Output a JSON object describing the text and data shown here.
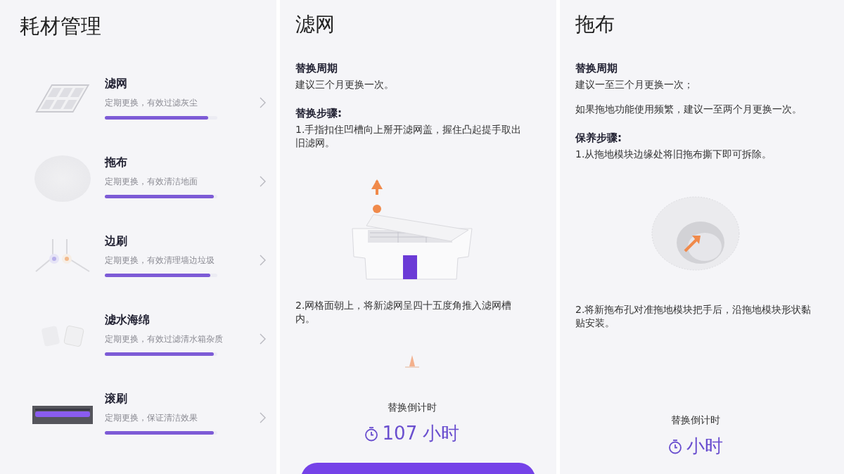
{
  "screens": [
    {
      "kind": "list",
      "title": "耗材管理",
      "items": [
        {
          "name": "滤网",
          "description": "定期更换，有效过滤灰尘",
          "level": 0.92,
          "kind": "filter"
        },
        {
          "name": "拖布",
          "description": "定期更换，有效清洁地面",
          "level": 0.97,
          "kind": "mop"
        },
        {
          "name": "边刷",
          "description": "定期更换，有效清理墙边垃圾",
          "level": 0.94,
          "kind": "side-brush"
        },
        {
          "name": "滤水海绵",
          "description": "定期更换，有效过滤清水箱杂质",
          "level": 0.97,
          "kind": "sponge"
        },
        {
          "name": "滚刷",
          "description": "定期更换，保证清洁效果",
          "level": 0.97,
          "kind": "roller-brush"
        }
      ]
    },
    {
      "kind": "detail",
      "title": "滤网",
      "blocks": [
        {
          "kind": "heading",
          "text": "替换周期"
        },
        {
          "kind": "text",
          "text": "建议三个月更换一次。"
        },
        {
          "kind": "heading",
          "text": "替换步骤:"
        },
        {
          "kind": "text",
          "text": "1.手指扣住凹槽向上掰开滤网盖，握住凸起提手取出旧滤网。"
        },
        {
          "kind": "filter-image"
        },
        {
          "kind": "text",
          "text": "2.网格面朝上，将新滤网呈四十五度角推入滤网槽内。"
        },
        {
          "kind": "arrow-image"
        }
      ],
      "countdown": {
        "label": "替换倒计时",
        "value": "107 小时"
      },
      "action_button": true
    },
    {
      "kind": "detail",
      "title": "拖布",
      "blocks": [
        {
          "kind": "heading",
          "text": "替换周期"
        },
        {
          "kind": "text",
          "text": "建议一至三个月更换一次；"
        },
        {
          "kind": "text",
          "text": "如果拖地功能使用频繁，建议一至两个月更换一次。"
        },
        {
          "kind": "heading",
          "text": "保养步骤:"
        },
        {
          "kind": "text",
          "text": "1.从拖地模块边缘处将旧拖布撕下即可拆除。"
        },
        {
          "kind": "mop-image"
        },
        {
          "kind": "text",
          "text": "2.将新拖布孔对准拖地模块把手后，沿拖地模块形状黏贴安装。"
        }
      ],
      "countdown": {
        "label": "替换倒计时",
        "value": "小时"
      },
      "action_button": false
    }
  ]
}
